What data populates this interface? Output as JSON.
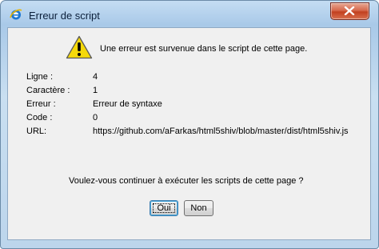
{
  "window": {
    "title": "Erreur de script",
    "app_icon": "internet-explorer-icon",
    "close_icon": "close-icon"
  },
  "dialog": {
    "icon": "warning-icon",
    "message": "Une erreur est survenue dans le script de cette page.",
    "details": [
      {
        "label": "Ligne :",
        "value": "4"
      },
      {
        "label": "Caractère :",
        "value": "1"
      },
      {
        "label": "Erreur :",
        "value": "Erreur de syntaxe"
      },
      {
        "label": "Code :",
        "value": "0"
      },
      {
        "label": "URL:",
        "value": "https://github.com/aFarkas/html5shiv/blob/master/dist/html5shiv.js"
      }
    ],
    "question": "Voulez-vous continuer à exécuter les scripts de cette page ?",
    "buttons": {
      "yes_label": "Oui",
      "no_label": "Non"
    }
  },
  "colors": {
    "close_button": "#c2401f",
    "warning_fill": "#f5d90a",
    "frame": "#a9c9e8"
  }
}
